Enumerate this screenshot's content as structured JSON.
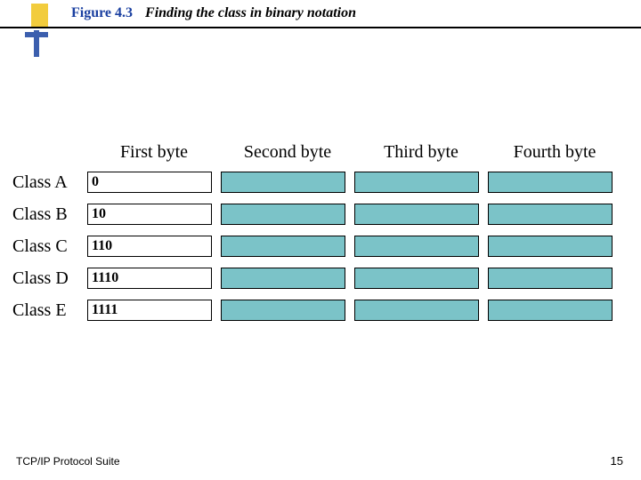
{
  "figure": {
    "number": "Figure 4.3",
    "title": "Finding the class in binary notation"
  },
  "columns": [
    "First byte",
    "Second byte",
    "Third byte",
    "Fourth byte"
  ],
  "rows": [
    {
      "label": "Class A",
      "prefix": "0"
    },
    {
      "label": "Class B",
      "prefix": "10"
    },
    {
      "label": "Class C",
      "prefix": "110"
    },
    {
      "label": "Class D",
      "prefix": "1110"
    },
    {
      "label": "Class E",
      "prefix": "1111"
    }
  ],
  "footer": "TCP/IP Protocol Suite",
  "page": "15",
  "chart_data": {
    "type": "table",
    "title": "Finding the class in binary notation",
    "columns": [
      "Class",
      "First byte prefix"
    ],
    "rows": [
      [
        "Class A",
        "0"
      ],
      [
        "Class B",
        "10"
      ],
      [
        "Class C",
        "110"
      ],
      [
        "Class D",
        "1110"
      ],
      [
        "Class E",
        "1111"
      ]
    ]
  }
}
